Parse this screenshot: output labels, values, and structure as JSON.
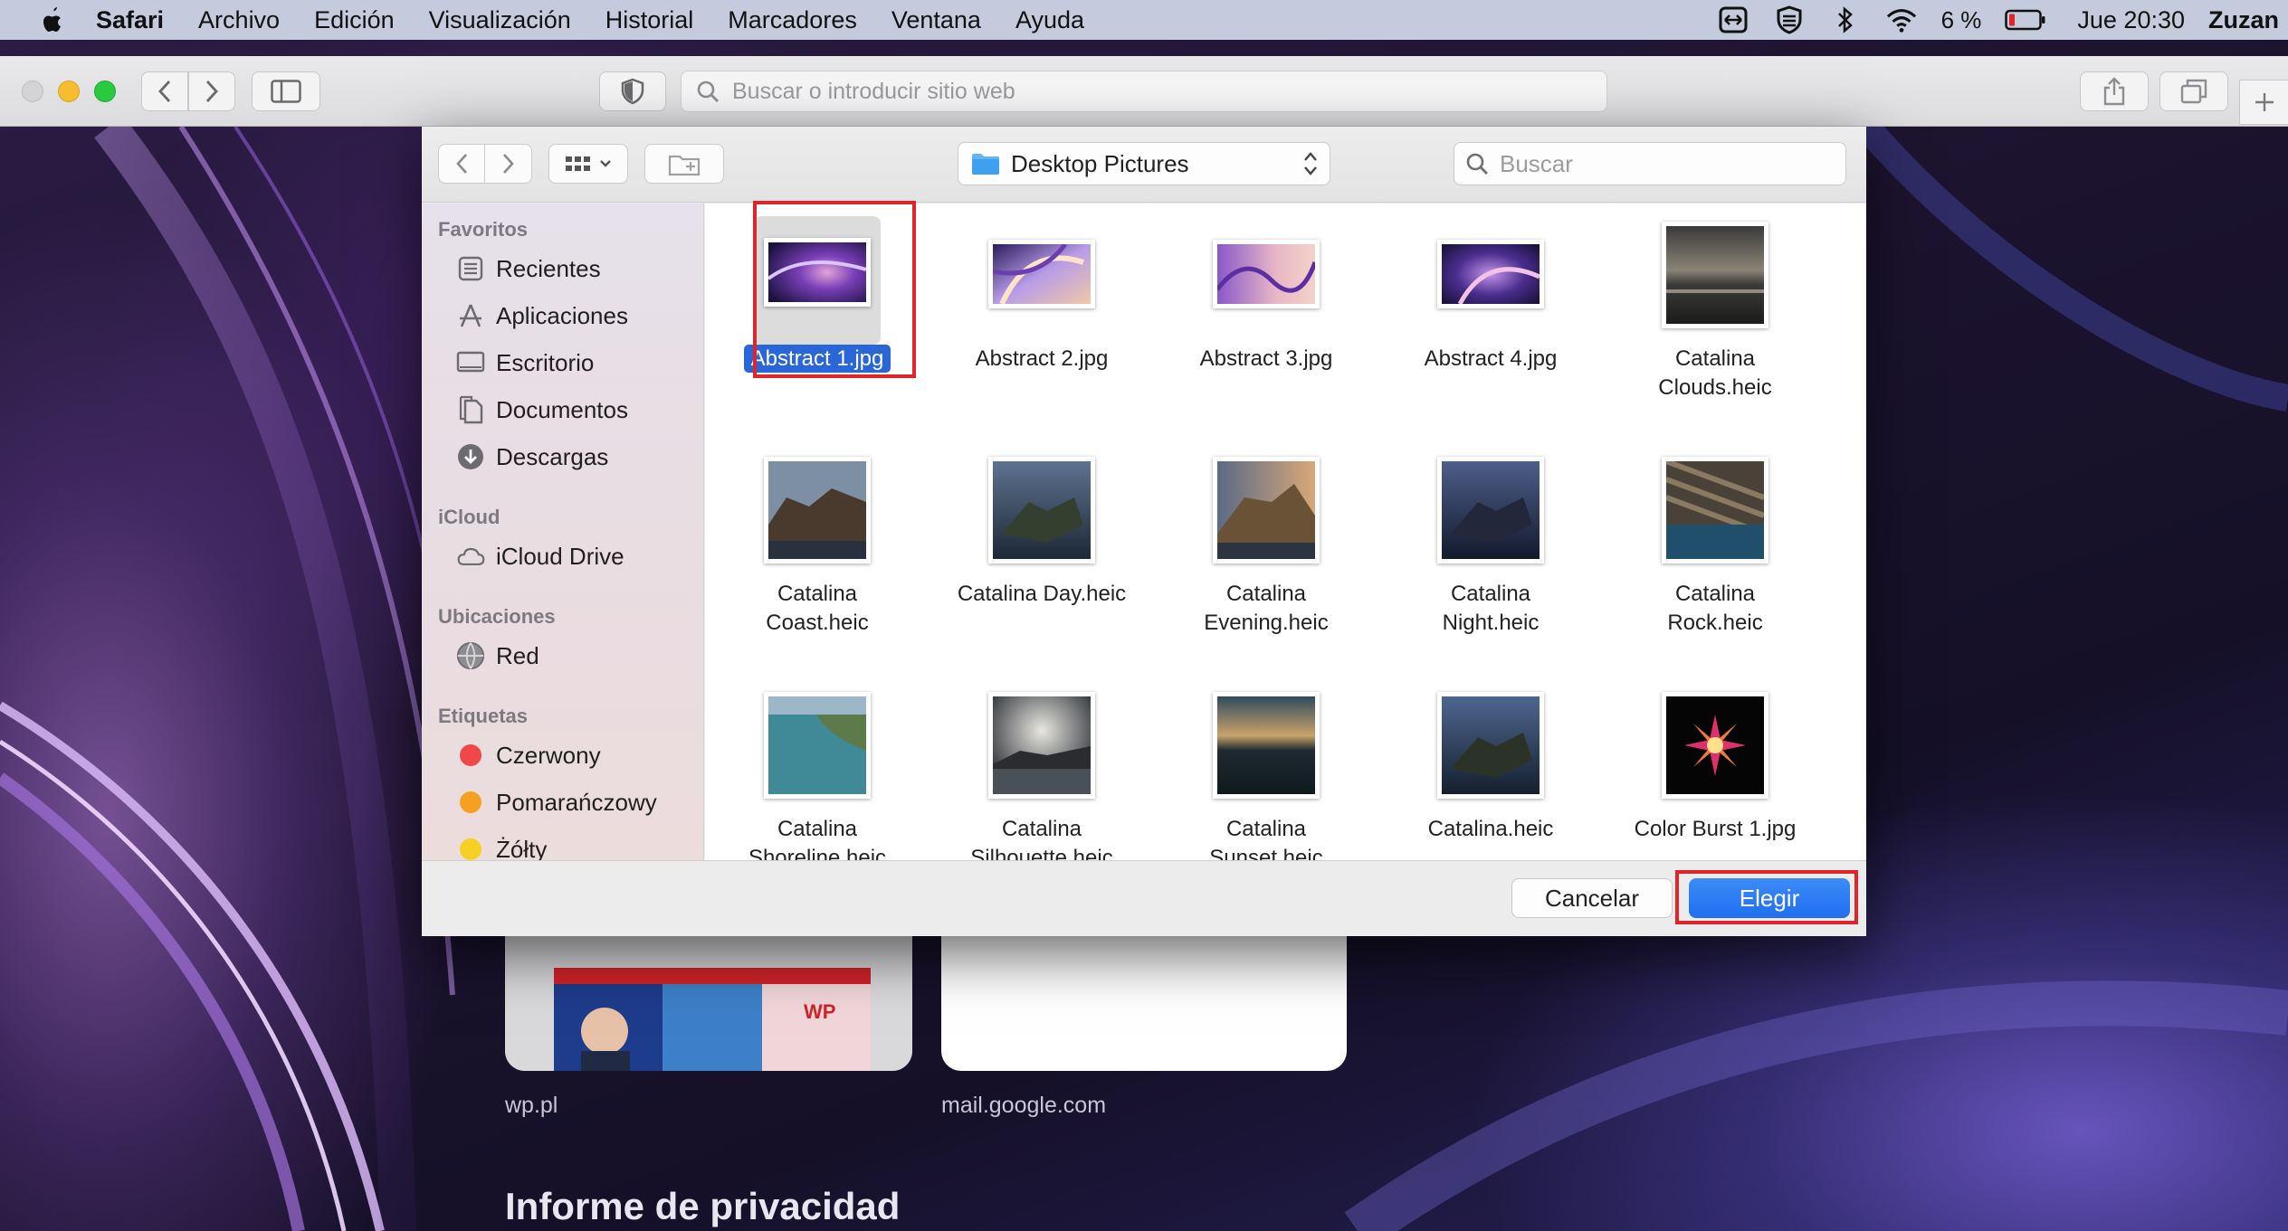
{
  "menubar": {
    "app_name": "Safari",
    "items": [
      "Archivo",
      "Edición",
      "Visualización",
      "Historial",
      "Marcadores",
      "Ventana",
      "Ayuda"
    ],
    "battery": "6 %",
    "clock": "Jue 20:30",
    "user": "Zuzan"
  },
  "safari": {
    "address_placeholder": "Buscar o introducir sitio web"
  },
  "start_page": {
    "tile1_label": "wp.pl",
    "tile2_label": "mail.google.com",
    "privacy_title": "Informe de privacidad"
  },
  "dialog": {
    "folder": "Desktop Pictures",
    "search_placeholder": "Buscar",
    "sidebar": {
      "favorites_title": "Favoritos",
      "favorites": [
        "Recientes",
        "Aplicaciones",
        "Escritorio",
        "Documentos",
        "Descargas"
      ],
      "icloud_title": "iCloud",
      "icloud": [
        "iCloud Drive"
      ],
      "locations_title": "Ubicaciones",
      "locations": [
        "Red"
      ],
      "tags_title": "Etiquetas",
      "tags": [
        {
          "label": "Czerwony",
          "color": "#f0474a"
        },
        {
          "label": "Pomarańczowy",
          "color": "#f6a021"
        },
        {
          "label": "Żółty",
          "color": "#f7cf25"
        }
      ]
    },
    "files": [
      {
        "name": "Abstract 1.jpg",
        "line1": "Abstract 1.jpg",
        "line2": "",
        "selected": true
      },
      {
        "name": "Abstract 2.jpg",
        "line1": "Abstract 2.jpg",
        "line2": ""
      },
      {
        "name": "Abstract 3.jpg",
        "line1": "Abstract 3.jpg",
        "line2": ""
      },
      {
        "name": "Abstract 4.jpg",
        "line1": "Abstract 4.jpg",
        "line2": ""
      },
      {
        "name": "Catalina Clouds.heic",
        "line1": "Catalina",
        "line2": "Clouds.heic"
      },
      {
        "name": "Catalina Coast.heic",
        "line1": "Catalina",
        "line2": "Coast.heic"
      },
      {
        "name": "Catalina Day.heic",
        "line1": "Catalina Day.heic",
        "line2": ""
      },
      {
        "name": "Catalina Evening.heic",
        "line1": "Catalina",
        "line2": "Evening.heic"
      },
      {
        "name": "Catalina Night.heic",
        "line1": "Catalina",
        "line2": "Night.heic"
      },
      {
        "name": "Catalina Rock.heic",
        "line1": "Catalina",
        "line2": "Rock.heic"
      },
      {
        "name": "Catalina Shoreline.heic",
        "line1": "Catalina",
        "line2": "Shoreline.heic"
      },
      {
        "name": "Catalina Silhouette.heic",
        "line1": "Catalina",
        "line2": "Silhouette.heic"
      },
      {
        "name": "Catalina Sunset.heic",
        "line1": "Catalina",
        "line2": "Sunset.heic"
      },
      {
        "name": "Catalina.heic",
        "line1": "Catalina.heic",
        "line2": ""
      },
      {
        "name": "Color Burst 1.jpg",
        "line1": "Color Burst 1.jpg",
        "line2": ""
      }
    ],
    "cancel_label": "Cancelar",
    "choose_label": "Elegir"
  },
  "colors": {
    "accent": "#2a66d8",
    "highlight_frame": "#e0242b"
  }
}
